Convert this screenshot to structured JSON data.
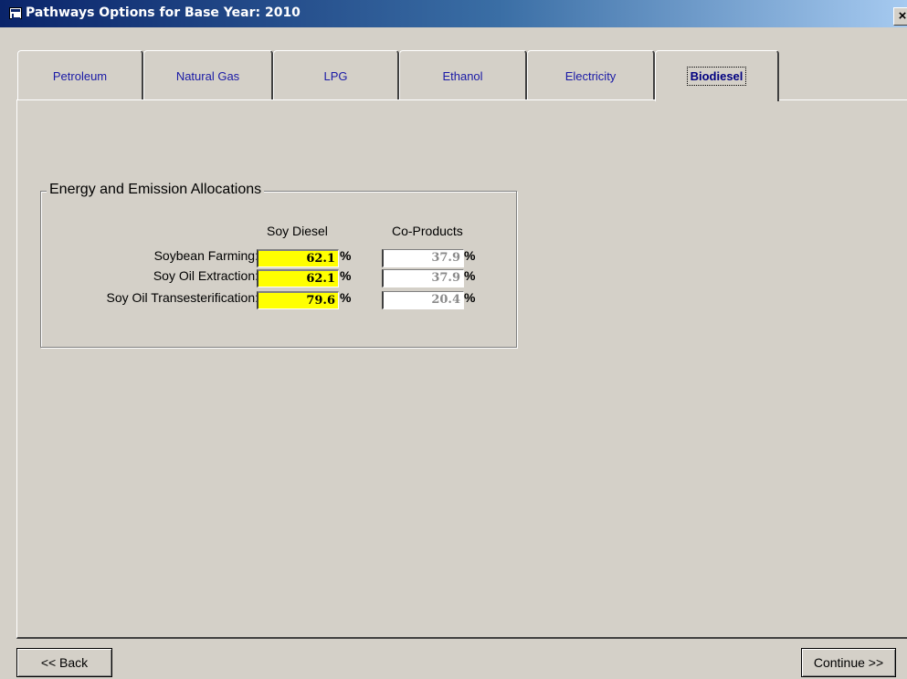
{
  "window": {
    "title": "Pathways Options for Base Year: 2010",
    "close_label": "×"
  },
  "tabs": [
    {
      "label": "Petroleum",
      "active": false
    },
    {
      "label": "Natural Gas",
      "active": false
    },
    {
      "label": "LPG",
      "active": false
    },
    {
      "label": "Ethanol",
      "active": false
    },
    {
      "label": "Electricity",
      "active": false
    },
    {
      "label": "Biodiesel",
      "active": true
    }
  ],
  "allocations": {
    "group_title": "Energy and Emission Allocations",
    "col_soy": "Soy Diesel",
    "col_co": "Co-Products",
    "unit": "%",
    "rows": [
      {
        "label": "Soybean Farming:",
        "soy": "62.1",
        "co": "37.9"
      },
      {
        "label": "Soy Oil Extraction:",
        "soy": "62.1",
        "co": "37.9"
      },
      {
        "label": "Soy Oil Transesterification:",
        "soy": "79.6",
        "co": "20.4"
      }
    ]
  },
  "buttons": {
    "back": "<< Back",
    "continue": "Continue >>"
  },
  "colors": {
    "highlight_field": "#ffff00",
    "titlebar_start": "#0a246a",
    "titlebar_end": "#a6caf0",
    "tab_text": "#1a1aa6"
  }
}
